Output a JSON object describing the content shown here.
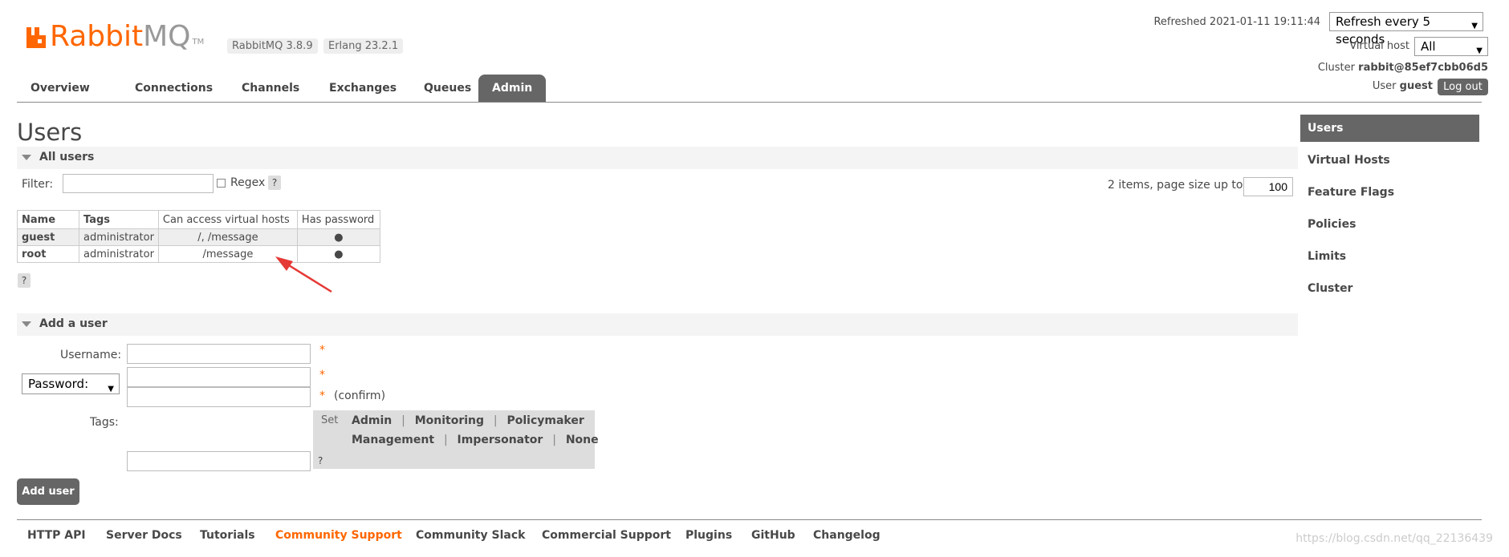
{
  "app": {
    "logo_primary": "Rabbit",
    "logo_secondary": "MQ",
    "logo_tm": "TM",
    "version_badge": "RabbitMQ 3.8.9",
    "erlang_badge": "Erlang 23.2.1"
  },
  "status": {
    "refreshed_label": "Refreshed 2021-01-11 19:11:44",
    "refresh_select": "Refresh every 5 seconds",
    "virtual_host_label": "Virtual host",
    "virtual_host_value": "All",
    "cluster_label": "Cluster",
    "cluster_value": "rabbit@85ef7cbb06d5",
    "user_label": "User",
    "user_value": "guest",
    "logout_label": "Log out"
  },
  "tabs": [
    {
      "label": "Overview",
      "active": false
    },
    {
      "label": "Connections",
      "active": false
    },
    {
      "label": "Channels",
      "active": false
    },
    {
      "label": "Exchanges",
      "active": false
    },
    {
      "label": "Queues",
      "active": false
    },
    {
      "label": "Admin",
      "active": true
    }
  ],
  "page": {
    "title": "Users",
    "all_users_section": "All users",
    "filter_label": "Filter:",
    "filter_value": "",
    "regex_label": "Regex",
    "help": "?",
    "pagination_text": "2 items, page size up to",
    "page_size": "100"
  },
  "users_table": {
    "headers": [
      "Name",
      "Tags",
      "Can access virtual hosts",
      "Has password"
    ],
    "rows": [
      {
        "name": "guest",
        "tags": "administrator",
        "vhosts": "/, /message",
        "has_password": "●"
      },
      {
        "name": "root",
        "tags": "administrator",
        "vhosts": "/message",
        "has_password": "●"
      }
    ]
  },
  "add_user": {
    "section": "Add a user",
    "username_label": "Username:",
    "password_select": "Password:",
    "required_mark": "*",
    "confirm_label": "(confirm)",
    "tags_label": "Tags:",
    "set_label": "Set",
    "tag_options_row1": [
      "Admin",
      "Monitoring",
      "Policymaker"
    ],
    "tag_options_row2": [
      "Management",
      "Impersonator",
      "None"
    ],
    "separator": "|",
    "submit_label": "Add user"
  },
  "right_nav": [
    {
      "label": "Users",
      "active": true
    },
    {
      "label": "Virtual Hosts",
      "active": false
    },
    {
      "label": "Feature Flags",
      "active": false
    },
    {
      "label": "Policies",
      "active": false
    },
    {
      "label": "Limits",
      "active": false
    },
    {
      "label": "Cluster",
      "active": false
    }
  ],
  "footer": [
    {
      "label": "HTTP API",
      "accent": false
    },
    {
      "label": "Server Docs",
      "accent": false
    },
    {
      "label": "Tutorials",
      "accent": false
    },
    {
      "label": "Community Support",
      "accent": true
    },
    {
      "label": "Community Slack",
      "accent": false
    },
    {
      "label": "Commercial Support",
      "accent": false
    },
    {
      "label": "Plugins",
      "accent": false
    },
    {
      "label": "GitHub",
      "accent": false
    },
    {
      "label": "Changelog",
      "accent": false
    }
  ],
  "watermark": "https://blog.csdn.net/qq_22136439",
  "colors": {
    "brand": "#ff6600",
    "annotation_arrow": "#e53935",
    "active_tab": "#666666"
  }
}
